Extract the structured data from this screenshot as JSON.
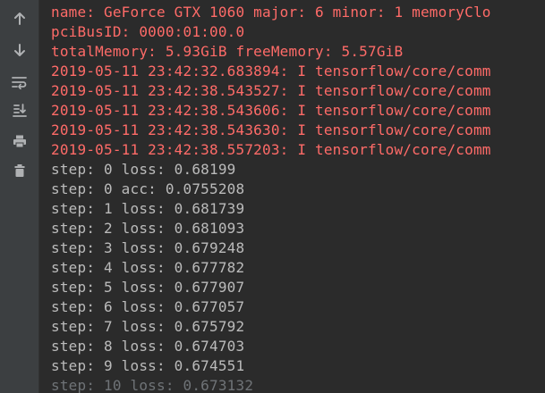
{
  "toolbar": {
    "icons": [
      "arrow-up-icon",
      "arrow-down-icon",
      "soft-wrap-icon",
      "scroll-to-end-icon",
      "print-icon",
      "trash-icon"
    ]
  },
  "console": {
    "stderr_lines": [
      "name: GeForce GTX 1060 major: 6 minor: 1 memoryClo",
      "pciBusID: 0000:01:00.0",
      "totalMemory: 5.93GiB freeMemory: 5.57GiB",
      "2019-05-11 23:42:32.683894: I tensorflow/core/comm",
      "2019-05-11 23:42:38.543527: I tensorflow/core/comm",
      "2019-05-11 23:42:38.543606: I tensorflow/core/comm",
      "2019-05-11 23:42:38.543630: I tensorflow/core/comm",
      "2019-05-11 23:42:38.557203: I tensorflow/core/comm"
    ],
    "stdout_lines": [
      "step: 0 loss: 0.68199",
      "step: 0 acc: 0.0755208",
      "step: 1 loss: 0.681739",
      "step: 2 loss: 0.681093",
      "step: 3 loss: 0.679248",
      "step: 4 loss: 0.677782",
      "step: 5 loss: 0.677907",
      "step: 6 loss: 0.677057",
      "step: 7 loss: 0.675792",
      "step: 8 loss: 0.674703",
      "step: 9 loss: 0.674551",
      "step: 10 loss: 0.673132"
    ]
  },
  "colors": {
    "background": "#2b2b2b",
    "toolbar": "#3c3f41",
    "stderr_text": "#ff6b68",
    "stdout_text": "#bbbbbb",
    "icon": "#afb1b3"
  }
}
